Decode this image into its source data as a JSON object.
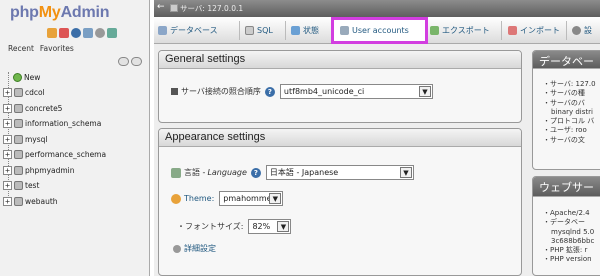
{
  "nav": {
    "logo": {
      "php": "php",
      "my": "My",
      "admin": "Admin"
    },
    "icons": [
      "home-icon",
      "logout-icon",
      "help-icon",
      "docs-icon",
      "settings-icon",
      "reload-icon"
    ],
    "tabs": [
      "Recent",
      "Favorites"
    ],
    "new_label": "New",
    "databases": [
      "cdcol",
      "concrete5",
      "information_schema",
      "mysql",
      "performance_schema",
      "phpmyadmin",
      "test",
      "webauth"
    ]
  },
  "serverbar": {
    "back": "←",
    "server": "サーバ: 127.0.0.1"
  },
  "topmenu": {
    "tabs": [
      "データベース",
      "SQL",
      "状態",
      "User accounts",
      "エクスポート",
      "インポート",
      "設"
    ],
    "active": "User accounts"
  },
  "general": {
    "title": "General settings",
    "collation_label": "サーバ接続の照合順序",
    "collation_value": "utf8mb4_unicode_ci"
  },
  "appearance": {
    "title": "Appearance settings",
    "language_label": "言語 - ",
    "language_label_italic": "Language",
    "language_value": "日本語 - Japanese",
    "theme_label": "Theme:",
    "theme_value": "pmahomme",
    "fontsize_label": "・フォントサイズ:",
    "fontsize_value": "82%",
    "more_settings": "詳細設定"
  },
  "db_server": {
    "title": "データベー",
    "items": [
      "サーバ: 127.0",
      "サーバの種",
      "サーバのバ",
      "binary distri",
      "プロトコル バ",
      "ユーザ: roo",
      "サーバの文"
    ]
  },
  "web_server": {
    "title": "ウェブサー",
    "items": [
      "Apache/2.4",
      "データベー",
      "mysqlnd 5.0",
      "3c688b6bbc",
      "PHP 拡張: r",
      "PHP version"
    ]
  },
  "colors": {
    "accent": "#d23ee0",
    "link": "#235a81"
  }
}
